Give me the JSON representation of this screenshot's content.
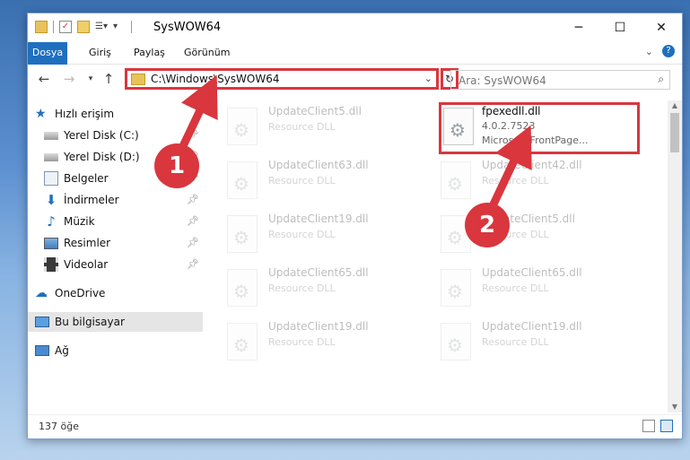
{
  "window": {
    "title": "SysWOW64"
  },
  "ribbon": {
    "tabs": [
      "Dosya",
      "Giriş",
      "Paylaş",
      "Görünüm"
    ]
  },
  "address": {
    "path": "C:\\Windows\\SysWOW64"
  },
  "search": {
    "placeholder": "Ara: SysWOW64"
  },
  "sidebar": {
    "items": [
      {
        "label": "Hızlı erişim"
      },
      {
        "label": "Yerel Disk (C:)"
      },
      {
        "label": "Yerel Disk (D:)"
      },
      {
        "label": "Belgeler"
      },
      {
        "label": "İndirmeler"
      },
      {
        "label": "Müzik"
      },
      {
        "label": "Resimler"
      },
      {
        "label": "Videolar"
      },
      {
        "label": "OneDrive"
      },
      {
        "label": "Bu bilgisayar"
      },
      {
        "label": "Ağ"
      }
    ]
  },
  "files": [
    {
      "name": "UpdateClient5.dll",
      "line2": "Resource DLL",
      "line3": ""
    },
    {
      "name": "fpexedll.dll",
      "line2": "4.0.2.7523",
      "line3": "Microsoft FrontPage..."
    },
    {
      "name": "UpdateClient63.dll",
      "line2": "Resource DLL",
      "line3": ""
    },
    {
      "name": "UpdateClient42.dll",
      "line2": "Resource DLL",
      "line3": ""
    },
    {
      "name": "UpdateClient19.dll",
      "line2": "Resource DLL",
      "line3": ""
    },
    {
      "name": "UpdateClient5.dll",
      "line2": "Resource DLL",
      "line3": ""
    },
    {
      "name": "UpdateClient65.dll",
      "line2": "Resource DLL",
      "line3": ""
    },
    {
      "name": "UpdateClient65.dll",
      "line2": "Resource DLL",
      "line3": ""
    },
    {
      "name": "UpdateClient19.dll",
      "line2": "Resource DLL",
      "line3": ""
    },
    {
      "name": "UpdateClient19.dll",
      "line2": "Resource DLL",
      "line3": ""
    }
  ],
  "status": {
    "count": "137 öğe"
  },
  "callouts": {
    "one": "1",
    "two": "2"
  },
  "colors": {
    "accent": "#1f6fbf",
    "highlight": "#d9363e"
  }
}
